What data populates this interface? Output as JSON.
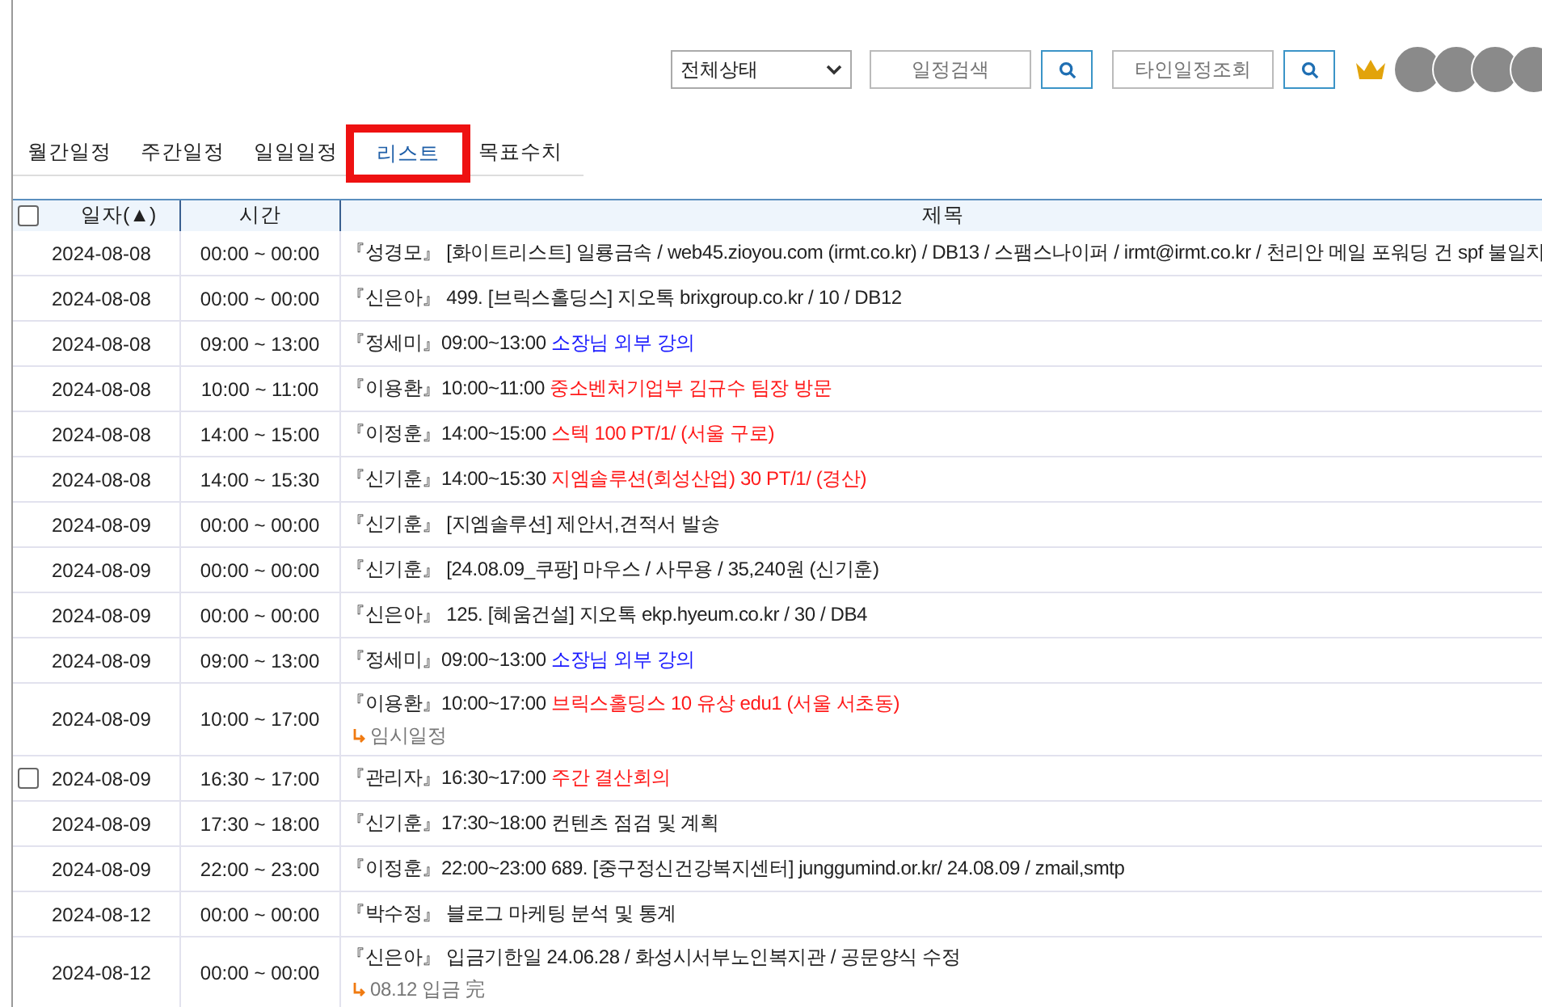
{
  "toolbar": {
    "status_select": "전체상태",
    "search": {
      "placeholder": "일정검색"
    },
    "others_search": {
      "placeholder": "타인일정조회"
    }
  },
  "tabs": [
    {
      "label": "월간일정",
      "selected": false,
      "highlighted": false
    },
    {
      "label": "주간일정",
      "selected": false,
      "highlighted": false
    },
    {
      "label": "일일일정",
      "selected": false,
      "highlighted": false
    },
    {
      "label": "리스트",
      "selected": true,
      "highlighted": true
    },
    {
      "label": "목표수치",
      "selected": false,
      "highlighted": false
    }
  ],
  "table": {
    "select_all": {
      "checked": false
    },
    "columns": [
      "일자(▲)",
      "시간",
      "제목"
    ],
    "rows": [
      {
        "date": "2024-08-08",
        "time": "00:00 ~ 00:00",
        "lead": "『성경모』 [화이트리스트] 일룡금속 / web45.zioyou.com (irmt.co.kr) / DB13 / 스팸스나이퍼 / irmt@irmt.co.kr / 천리안 메일 포워딩 건 spf 불일치",
        "text": "",
        "color": "#222222"
      },
      {
        "date": "2024-08-08",
        "time": "00:00 ~ 00:00",
        "lead": "『신은아』 499. [브릭스홀딩스] 지오톡 brixgroup.co.kr / 10 / DB12",
        "text": "",
        "color": "#222222"
      },
      {
        "date": "2024-08-08",
        "time": "09:00 ~ 13:00",
        "lead": "『정세미』09:00~13:00",
        "text": "소장님 외부 강의",
        "color": "#1a1aff"
      },
      {
        "date": "2024-08-08",
        "time": "10:00 ~ 11:00",
        "lead": "『이용환』10:00~11:00",
        "text": "중소벤처기업부 김규수 팀장 방문",
        "color": "#ff1a1a"
      },
      {
        "date": "2024-08-08",
        "time": "14:00 ~ 15:00",
        "lead": "『이정훈』14:00~15:00",
        "text": "스텍 100 PT/1/ (서울 구로)",
        "color": "#ff1a1a"
      },
      {
        "date": "2024-08-08",
        "time": "14:00 ~ 15:30",
        "lead": "『신기훈』14:00~15:30",
        "text": "지엠솔루션(회성산업) 30 PT/1/ (경산)",
        "color": "#ff1a1a"
      },
      {
        "date": "2024-08-09",
        "time": "00:00 ~ 00:00",
        "lead": "『신기훈』 [지엠솔루션] 제안서,견적서 발송",
        "text": "",
        "color": "#222222"
      },
      {
        "date": "2024-08-09",
        "time": "00:00 ~ 00:00",
        "lead": "『신기훈』 [24.08.09_쿠팡] 마우스 / 사무용 / 35,240원 (신기훈)",
        "text": "",
        "color": "#222222"
      },
      {
        "date": "2024-08-09",
        "time": "00:00 ~ 00:00",
        "lead": "『신은아』 125. [혜움건설] 지오톡 ekp.hyeum.co.kr / 30 / DB4",
        "text": "",
        "color": "#222222"
      },
      {
        "date": "2024-08-09",
        "time": "09:00 ~ 13:00",
        "lead": "『정세미』09:00~13:00",
        "text": "소장님 외부 강의",
        "color": "#1a1aff"
      },
      {
        "date": "2024-08-09",
        "time": "10:00 ~ 17:00",
        "lead": "『이용환』10:00~17:00",
        "text": "브릭스홀딩스 10 유상 edu1 (서울 서초동)",
        "color": "#ff1a1a",
        "note": "임시일정"
      },
      {
        "date": "2024-08-09",
        "time": "16:30 ~ 17:00",
        "lead": "『관리자』16:30~17:00",
        "text": "주간 결산회의",
        "color": "#ff1a1a",
        "checkbox": {
          "checked": false
        }
      },
      {
        "date": "2024-08-09",
        "time": "17:30 ~ 18:00",
        "lead": "『신기훈』17:30~18:00 컨텐츠 점검 및 계획",
        "text": "",
        "color": "#222222"
      },
      {
        "date": "2024-08-09",
        "time": "22:00 ~ 23:00",
        "lead": "『이정훈』22:00~23:00 689. [중구정신건강복지센터] junggumind.or.kr/ 24.08.09 / zmail,smtp",
        "text": "",
        "color": "#222222"
      },
      {
        "date": "2024-08-12",
        "time": "00:00 ~ 00:00",
        "lead": "『박수정』 블로그 마케팅 분석 및 통계",
        "text": "",
        "color": "#222222"
      },
      {
        "date": "2024-08-12",
        "time": "00:00 ~ 00:00",
        "lead": "『신은아』 입금기한일 24.06.28 / 화성시서부노인복지관 / 공문양식 수정",
        "text": "",
        "color": "#222222",
        "note": "08.12 입금 完"
      }
    ]
  }
}
